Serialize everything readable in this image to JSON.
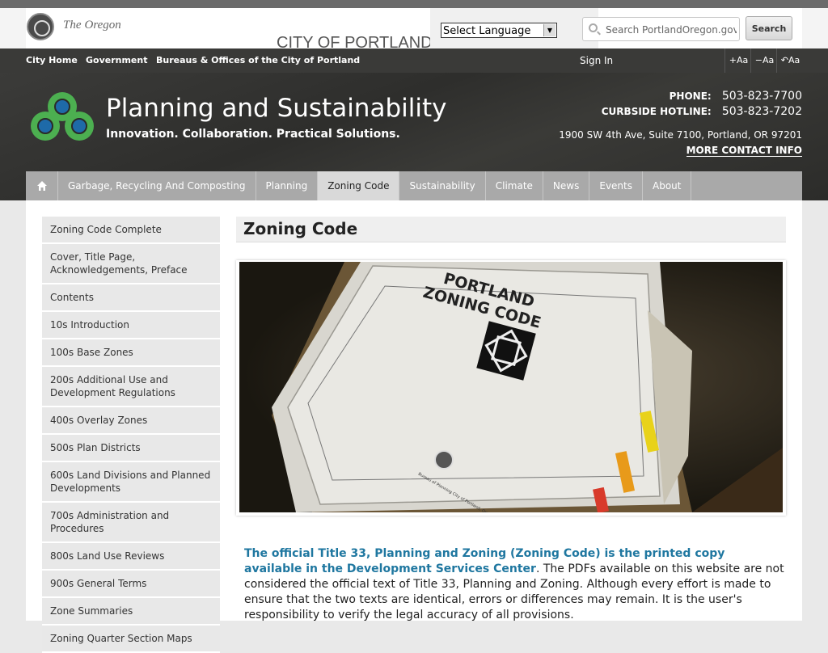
{
  "site": {
    "city_the": "The",
    "city_name": "CITY OF PORTLAND",
    "city_state": "Oregon",
    "language_select": "Select Language",
    "search_placeholder": "Search PortlandOregon.gov",
    "search_button": "Search"
  },
  "topnav": {
    "links": [
      "City Home",
      "Government",
      "Bureaus & Offices of the City of Portland"
    ],
    "sign_in": "Sign In",
    "font_controls": [
      "+Aa",
      "−Aa",
      "↶Aa"
    ]
  },
  "header": {
    "title": "Planning and Sustainability",
    "tagline": "Innovation. Collaboration. Practical Solutions.",
    "phone_label": "PHONE:",
    "phone": "503-823-7700",
    "hotline_label": "CURBSIDE HOTLINE:",
    "hotline": "503-823-7202",
    "address": "1900 SW 4th Ave, Suite 7100, Portland, OR 97201",
    "more_contact": "MORE CONTACT INFO"
  },
  "mainnav": {
    "tabs": [
      "Garbage, Recycling And Composting",
      "Planning",
      "Zoning Code",
      "Sustainability",
      "Climate",
      "News",
      "Events",
      "About"
    ],
    "active_tab": "Zoning Code"
  },
  "sidebar": {
    "items": [
      "Zoning Code Complete",
      "Cover, Title Page, Acknowledgements, Preface",
      "Contents",
      "10s Introduction",
      "100s Base Zones",
      "200s Additional Use and Development Regulations",
      "400s Overlay Zones",
      "500s Plan Districts",
      "600s Land Divisions and Planned Developments",
      "700s Administration and Procedures",
      "800s Land Use Reviews",
      "900s General Terms",
      "Zone Summaries",
      "Zoning Quarter Section Maps"
    ]
  },
  "main": {
    "page_title": "Zoning Code",
    "hero": {
      "book_line1": "PORTLAND",
      "book_line2": "ZONING CODE",
      "seal_caption": "Bureau of Planning City of Portland, Oregon January 1991"
    },
    "intro_lead": "The official Title 33, Planning and Zoning (Zoning Code) is the printed copy available in the Development Services Center",
    "intro_rest": ". The PDFs available on this website are not considered the official text of Title 33, Planning and Zoning. Although every effort is made to ensure that the two texts are identical, errors or differences may remain. It is the user's responsibility to verify the legal accuracy of all provisions."
  },
  "colors": {
    "header_bg": "#2e2e2c",
    "nav_gray": "#a9a9a9",
    "link_blue": "#1f77a0",
    "logo_green": "#4caf50",
    "logo_blue": "#1e6aa8"
  }
}
